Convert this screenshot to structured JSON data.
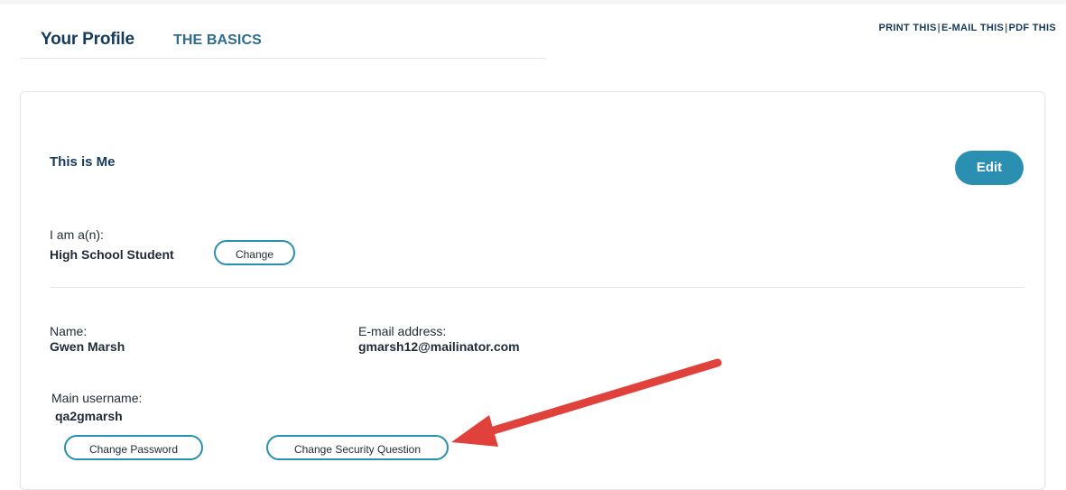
{
  "tabs": {
    "profile": "Your Profile",
    "basics": "THE BASICS"
  },
  "tools": {
    "print": "PRINT THIS",
    "email": "E-MAIL THIS",
    "pdf": "PDF THIS",
    "separator": "|"
  },
  "section": {
    "title": "This is Me",
    "edit_label": "Edit"
  },
  "role": {
    "label": "I am a(n):",
    "value": "High School Student",
    "change_label": "Change"
  },
  "name": {
    "label": "Name:",
    "value": "Gwen Marsh"
  },
  "email": {
    "label": "E-mail address:",
    "value": "gmarsh12@mailinator.com"
  },
  "username": {
    "label": "Main username:",
    "value": "qa2gmarsh"
  },
  "actions": {
    "change_password": "Change Password",
    "change_security": "Change Security Question"
  },
  "colors": {
    "accent": "#2a8fb0",
    "navy": "#163a5a",
    "annotation_arrow": "#e0413a"
  }
}
